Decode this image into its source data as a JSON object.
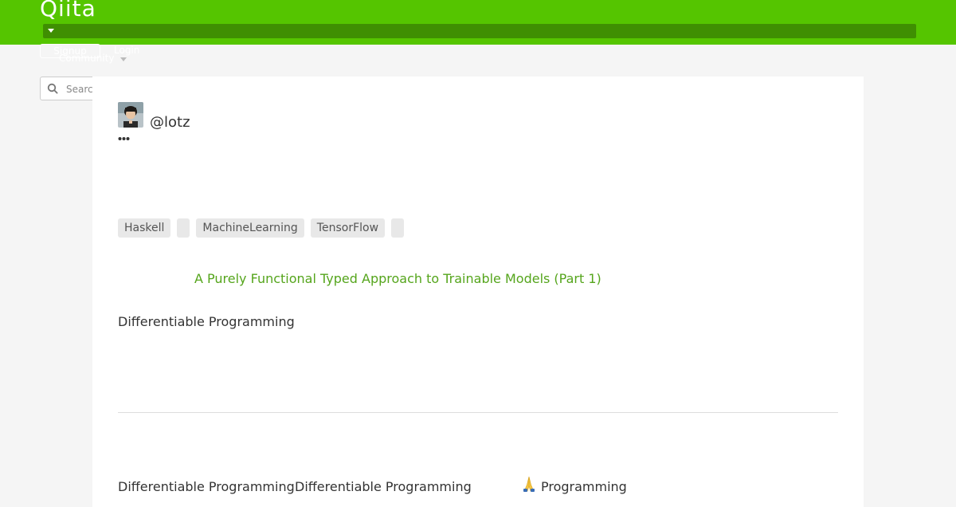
{
  "header": {
    "logo": "Qiita",
    "signup_label": "Signup",
    "login_label": "Login",
    "community_label": "Community",
    "accent_color": "#55c500"
  },
  "search": {
    "placeholder": "Search"
  },
  "author": {
    "username": "@lotz"
  },
  "tags": [
    "Haskell",
    "",
    "MachineLearning",
    "TensorFlow",
    ""
  ],
  "article": {
    "related_link": "A Purely Functional Typed Approach to Trainable Models (Part 1)",
    "heading": "Differentiable Programming",
    "paragraph_a": "Differentiable Programming",
    "paragraph_b": "Differentiable Programming",
    "paragraph_c": "Programming"
  },
  "icons": {
    "search": "search-icon",
    "more": "more-icon",
    "pray": "folded-hands-icon",
    "caret": "chevron-down-icon"
  }
}
